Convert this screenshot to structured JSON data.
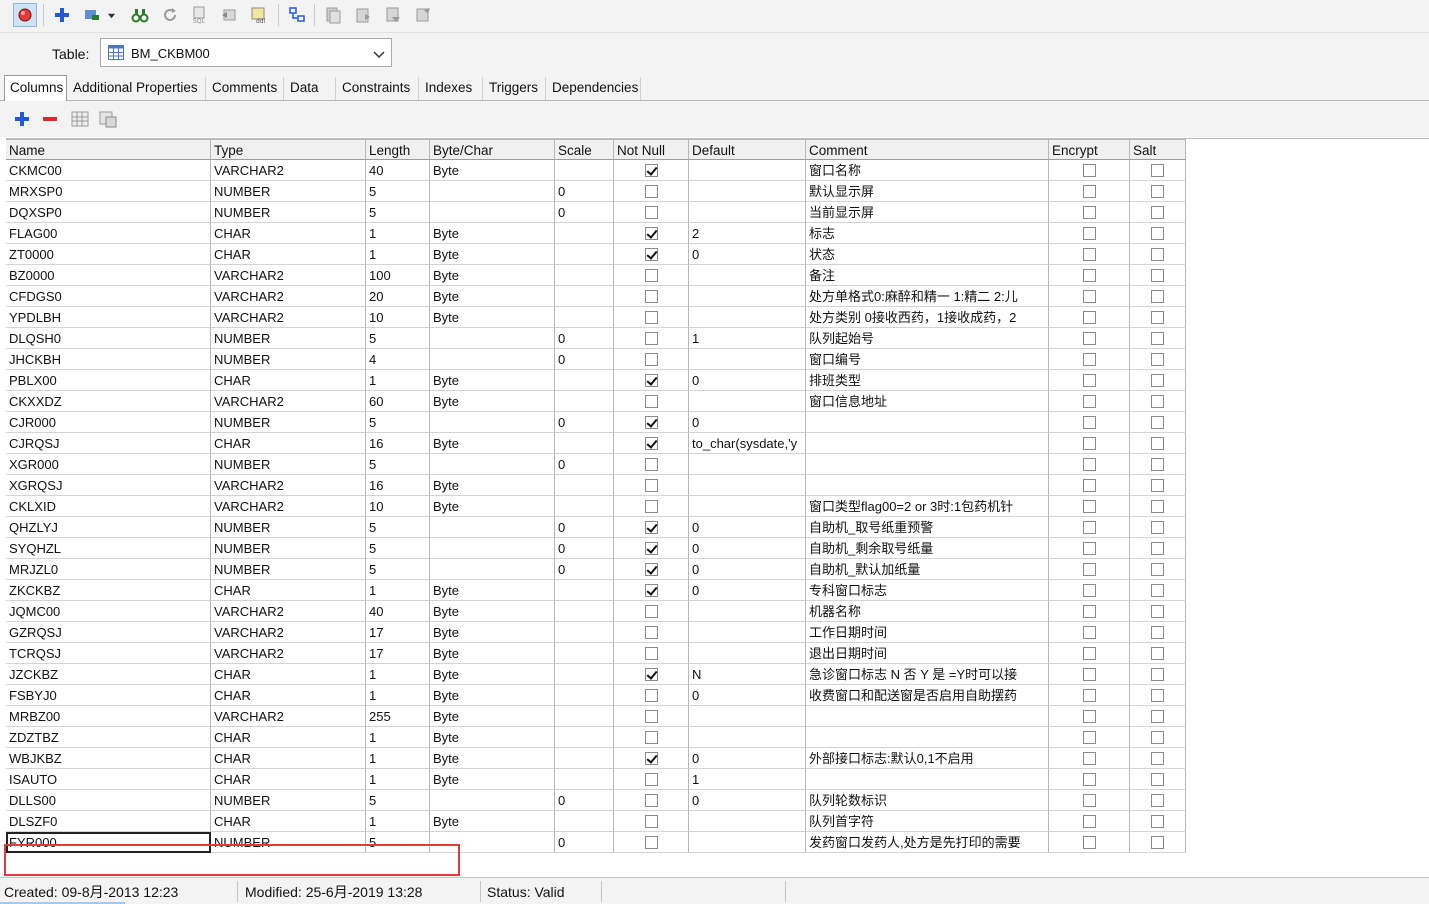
{
  "toolbar": {
    "icons": [
      "record-icon",
      "add-plus-icon",
      "edit-dropdown-icon",
      "dropdown-arrow-icon",
      "refresh-binoculars-icon",
      "reload-icon",
      "sql-icon",
      "export-icon",
      "ddl-icon",
      "tree-icon",
      "copy-icon",
      "paste-icon",
      "print-icon",
      "settings-icon"
    ]
  },
  "table_select": {
    "label": "Table:",
    "value": "BM_CKBM00"
  },
  "tabs": [
    "Columns",
    "Additional Properties",
    "Comments",
    "Data",
    "Constraints",
    "Indexes",
    "Triggers",
    "Dependencies"
  ],
  "selected_tab": "Columns",
  "grid": {
    "headers": [
      "Name",
      "Type",
      "Length",
      "Byte/Char",
      "Scale",
      "Not Null",
      "Default",
      "Comment",
      "Encrypt",
      "Salt"
    ],
    "rows": [
      {
        "name": "CKMC00",
        "type": "VARCHAR2",
        "length": "40",
        "bytechar": "Byte",
        "scale": "",
        "notnull": true,
        "default": "",
        "comment": "窗口名称"
      },
      {
        "name": "MRXSP0",
        "type": "NUMBER",
        "length": "5",
        "bytechar": "",
        "scale": "0",
        "notnull": false,
        "default": "",
        "comment": "默认显示屏"
      },
      {
        "name": "DQXSP0",
        "type": "NUMBER",
        "length": "5",
        "bytechar": "",
        "scale": "0",
        "notnull": false,
        "default": "",
        "comment": "当前显示屏"
      },
      {
        "name": "FLAG00",
        "type": "CHAR",
        "length": "1",
        "bytechar": "Byte",
        "scale": "",
        "notnull": true,
        "default": "2",
        "comment": "标志"
      },
      {
        "name": "ZT0000",
        "type": "CHAR",
        "length": "1",
        "bytechar": "Byte",
        "scale": "",
        "notnull": true,
        "default": "0",
        "comment": "状态"
      },
      {
        "name": "BZ0000",
        "type": "VARCHAR2",
        "length": "100",
        "bytechar": "Byte",
        "scale": "",
        "notnull": false,
        "default": "",
        "comment": "备注"
      },
      {
        "name": "CFDGS0",
        "type": "VARCHAR2",
        "length": "20",
        "bytechar": "Byte",
        "scale": "",
        "notnull": false,
        "default": "",
        "comment": "处方单格式0:麻醉和精一 1:精二 2:儿"
      },
      {
        "name": "YPDLBH",
        "type": "VARCHAR2",
        "length": "10",
        "bytechar": "Byte",
        "scale": "",
        "notnull": false,
        "default": "",
        "comment": "处方类别 0接收西药，1接收成药，2"
      },
      {
        "name": "DLQSH0",
        "type": "NUMBER",
        "length": "5",
        "bytechar": "",
        "scale": "0",
        "notnull": false,
        "default": "1",
        "comment": "队列起始号"
      },
      {
        "name": "JHCKBH",
        "type": "NUMBER",
        "length": "4",
        "bytechar": "",
        "scale": "0",
        "notnull": false,
        "default": "",
        "comment": "窗口编号"
      },
      {
        "name": "PBLX00",
        "type": "CHAR",
        "length": "1",
        "bytechar": "Byte",
        "scale": "",
        "notnull": true,
        "default": "0",
        "comment": "排班类型"
      },
      {
        "name": "CKXXDZ",
        "type": "VARCHAR2",
        "length": "60",
        "bytechar": "Byte",
        "scale": "",
        "notnull": false,
        "default": "",
        "comment": "窗口信息地址"
      },
      {
        "name": "CJR000",
        "type": "NUMBER",
        "length": "5",
        "bytechar": "",
        "scale": "0",
        "notnull": true,
        "default": "0",
        "comment": ""
      },
      {
        "name": "CJRQSJ",
        "type": "CHAR",
        "length": "16",
        "bytechar": "Byte",
        "scale": "",
        "notnull": true,
        "default": "to_char(sysdate,'y",
        "comment": ""
      },
      {
        "name": "XGR000",
        "type": "NUMBER",
        "length": "5",
        "bytechar": "",
        "scale": "0",
        "notnull": false,
        "default": "",
        "comment": ""
      },
      {
        "name": "XGRQSJ",
        "type": "VARCHAR2",
        "length": "16",
        "bytechar": "Byte",
        "scale": "",
        "notnull": false,
        "default": "",
        "comment": ""
      },
      {
        "name": "CKLXID",
        "type": "VARCHAR2",
        "length": "10",
        "bytechar": "Byte",
        "scale": "",
        "notnull": false,
        "default": "",
        "comment": "窗口类型flag00=2 or 3时:1包药机针"
      },
      {
        "name": "QHZLYJ",
        "type": "NUMBER",
        "length": "5",
        "bytechar": "",
        "scale": "0",
        "notnull": true,
        "default": "0",
        "comment": "自助机_取号纸重预警"
      },
      {
        "name": "SYQHZL",
        "type": "NUMBER",
        "length": "5",
        "bytechar": "",
        "scale": "0",
        "notnull": true,
        "default": "0",
        "comment": "自助机_剩余取号纸量"
      },
      {
        "name": "MRJZL0",
        "type": "NUMBER",
        "length": "5",
        "bytechar": "",
        "scale": "0",
        "notnull": true,
        "default": "0",
        "comment": "自助机_默认加纸量"
      },
      {
        "name": "ZKCKBZ",
        "type": "CHAR",
        "length": "1",
        "bytechar": "Byte",
        "scale": "",
        "notnull": true,
        "default": "0",
        "comment": "专科窗口标志"
      },
      {
        "name": "JQMC00",
        "type": "VARCHAR2",
        "length": "40",
        "bytechar": "Byte",
        "scale": "",
        "notnull": false,
        "default": "",
        "comment": "机器名称"
      },
      {
        "name": "GZRQSJ",
        "type": "VARCHAR2",
        "length": "17",
        "bytechar": "Byte",
        "scale": "",
        "notnull": false,
        "default": "",
        "comment": "工作日期时间"
      },
      {
        "name": "TCRQSJ",
        "type": "VARCHAR2",
        "length": "17",
        "bytechar": "Byte",
        "scale": "",
        "notnull": false,
        "default": "",
        "comment": "退出日期时间"
      },
      {
        "name": "JZCKBZ",
        "type": "CHAR",
        "length": "1",
        "bytechar": "Byte",
        "scale": "",
        "notnull": true,
        "default": "N",
        "comment": "急诊窗口标志 N 否 Y 是 =Y时可以接"
      },
      {
        "name": "FSBYJ0",
        "type": "CHAR",
        "length": "1",
        "bytechar": "Byte",
        "scale": "",
        "notnull": false,
        "default": "0",
        "comment": "收费窗口和配送窗是否启用自助摆药"
      },
      {
        "name": "MRBZ00",
        "type": "VARCHAR2",
        "length": "255",
        "bytechar": "Byte",
        "scale": "",
        "notnull": false,
        "default": "",
        "comment": ""
      },
      {
        "name": "ZDZTBZ",
        "type": "CHAR",
        "length": "1",
        "bytechar": "Byte",
        "scale": "",
        "notnull": false,
        "default": "",
        "comment": ""
      },
      {
        "name": "WBJKBZ",
        "type": "CHAR",
        "length": "1",
        "bytechar": "Byte",
        "scale": "",
        "notnull": true,
        "default": "0",
        "comment": "外部接口标志:默认0,1不启用"
      },
      {
        "name": "ISAUTO",
        "type": "CHAR",
        "length": "1",
        "bytechar": "Byte",
        "scale": "",
        "notnull": false,
        "default": "1",
        "comment": ""
      },
      {
        "name": "DLLS00",
        "type": "NUMBER",
        "length": "5",
        "bytechar": "",
        "scale": "0",
        "notnull": false,
        "default": "0",
        "comment": "队列轮数标识"
      },
      {
        "name": "DLSZF0",
        "type": "CHAR",
        "length": "1",
        "bytechar": "Byte",
        "scale": "",
        "notnull": false,
        "default": "",
        "comment": "队列首字符"
      },
      {
        "name": "FYR000",
        "type": "NUMBER",
        "length": "5",
        "bytechar": "",
        "scale": "0",
        "notnull": false,
        "default": "",
        "comment": "发药窗口发药人,处方是先打印的需要"
      }
    ]
  },
  "status": {
    "created": "Created: 09-8月-2013 12:23",
    "modified": "Modified: 25-6月-2019 13:28",
    "status": "Status: Valid"
  }
}
